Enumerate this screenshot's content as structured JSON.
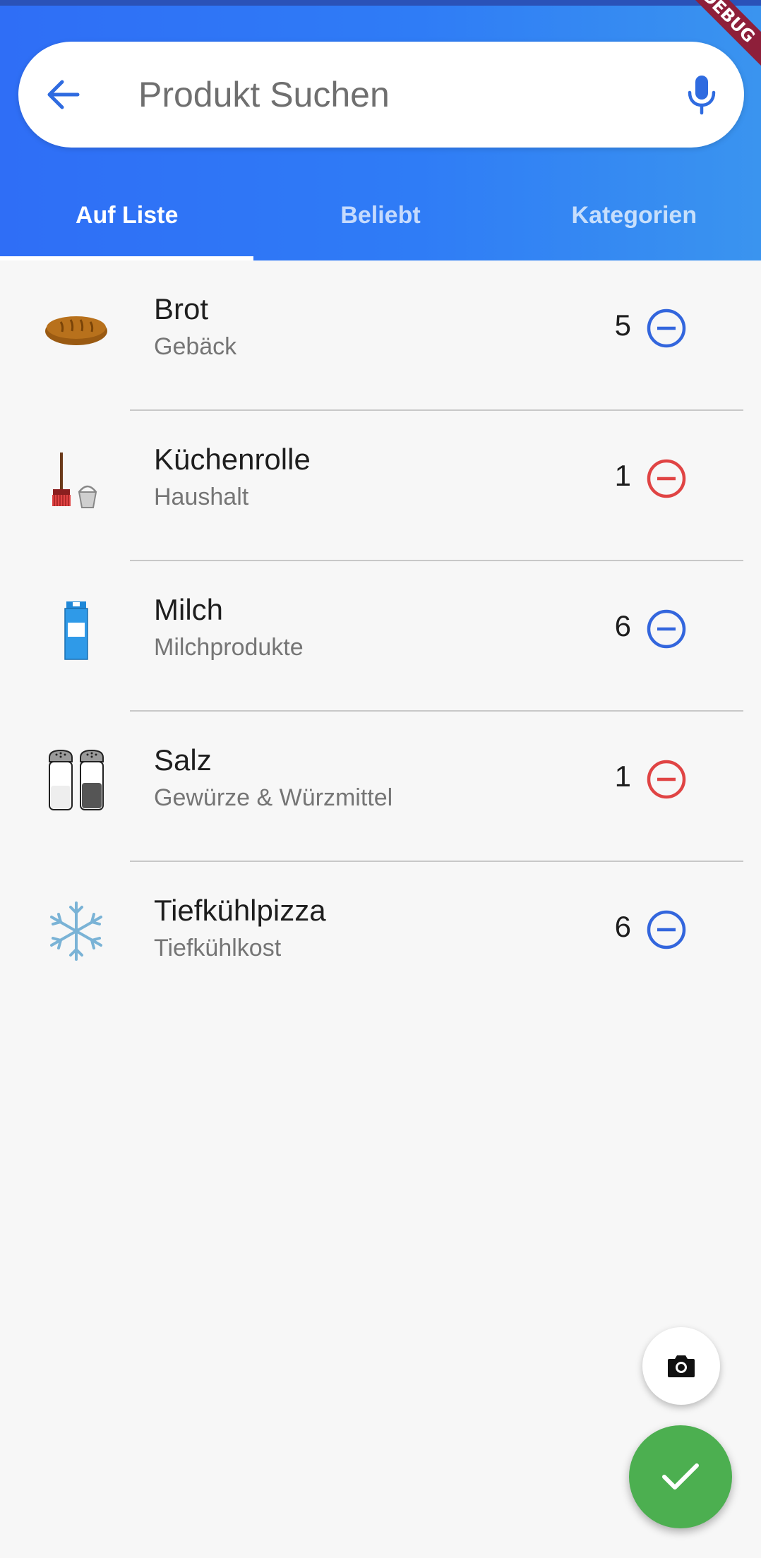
{
  "debug_banner": "DEBUG",
  "search": {
    "placeholder": "Produkt Suchen",
    "value": ""
  },
  "tabs": [
    {
      "label": "Auf Liste",
      "active": true
    },
    {
      "label": "Beliebt",
      "active": false
    },
    {
      "label": "Kategorien",
      "active": false
    }
  ],
  "items": [
    {
      "name": "Brot",
      "category": "Gebäck",
      "quantity": "5",
      "icon": "bread-icon",
      "remove_color": "#3366dd"
    },
    {
      "name": "Küchenrolle",
      "category": "Haushalt",
      "quantity": "1",
      "icon": "cleaning-supplies-icon",
      "remove_color": "#e04444"
    },
    {
      "name": "Milch",
      "category": "Milchprodukte",
      "quantity": "6",
      "icon": "milk-carton-icon",
      "remove_color": "#3366dd"
    },
    {
      "name": "Salz",
      "category": "Gewürze & Würzmittel",
      "quantity": "1",
      "icon": "salt-pepper-shakers-icon",
      "remove_color": "#e04444"
    },
    {
      "name": "Tiefkühlpizza",
      "category": "Tiefkühlkost",
      "quantity": "6",
      "icon": "snowflake-icon",
      "remove_color": "#3366dd"
    }
  ],
  "colors": {
    "header_start": "#2f6ef6",
    "header_end": "#3a94ef",
    "accent": "#3366dd",
    "remove_red": "#e04444",
    "confirm_green": "#4caf50"
  },
  "fabs": {
    "camera_icon": "camera-icon",
    "confirm_icon": "check-icon"
  }
}
